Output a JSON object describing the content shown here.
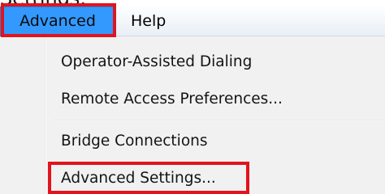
{
  "heading": {
    "text": "Settings."
  },
  "menubar": {
    "items": [
      {
        "label": "Advanced",
        "state": "open"
      },
      {
        "label": "Help"
      }
    ]
  },
  "dropdown": {
    "groups": [
      {
        "items": [
          {
            "label": "Operator-Assisted Dialing"
          },
          {
            "label": "Remote Access Preferences..."
          }
        ]
      },
      {
        "items": [
          {
            "label": "Bridge Connections"
          },
          {
            "label": "Advanced Settings..."
          }
        ]
      }
    ]
  },
  "colors": {
    "highlight": "#3399ff",
    "annotation": "#e1141d",
    "menu_background": "#f1f1f1"
  }
}
